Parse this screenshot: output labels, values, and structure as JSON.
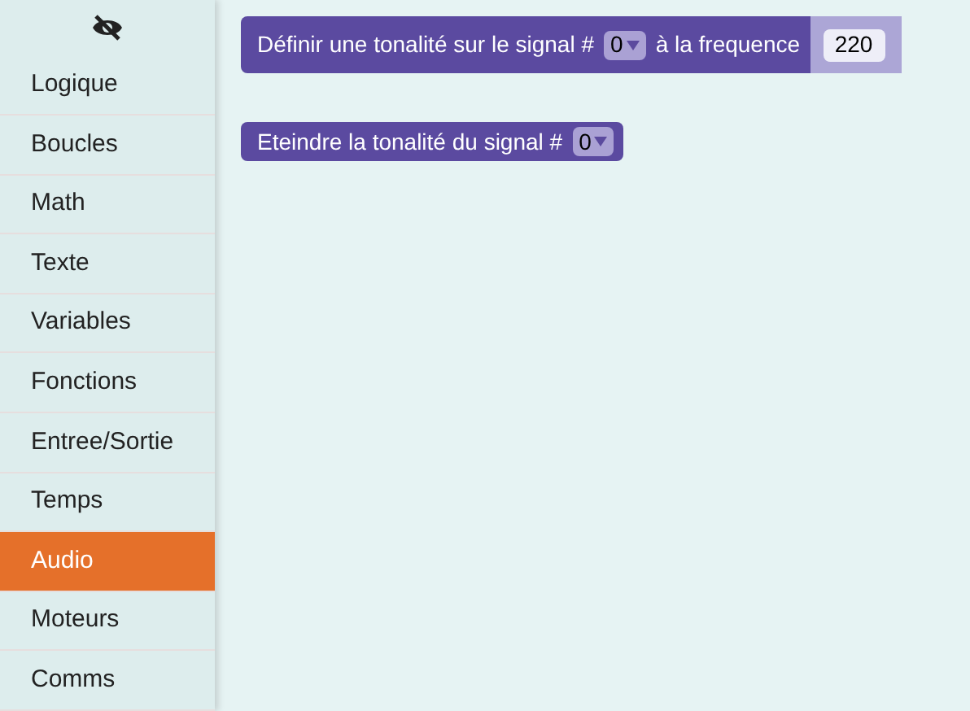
{
  "sidebar": {
    "items": [
      {
        "label": "Logique",
        "selected": false
      },
      {
        "label": "Boucles",
        "selected": false
      },
      {
        "label": "Math",
        "selected": false
      },
      {
        "label": "Texte",
        "selected": false
      },
      {
        "label": "Variables",
        "selected": false
      },
      {
        "label": "Fonctions",
        "selected": false
      },
      {
        "label": "Entree/Sortie",
        "selected": false
      },
      {
        "label": "Temps",
        "selected": false
      },
      {
        "label": "Audio",
        "selected": true
      },
      {
        "label": "Moteurs",
        "selected": false
      },
      {
        "label": "Comms",
        "selected": false
      }
    ]
  },
  "blocks": [
    {
      "parts": [
        {
          "kind": "text",
          "text": "Définir une tonalité sur le signal #"
        },
        {
          "kind": "dropdown",
          "value": "0"
        },
        {
          "kind": "text",
          "text": "à la frequence"
        },
        {
          "kind": "number",
          "value": "220"
        }
      ]
    },
    {
      "parts": [
        {
          "kind": "text",
          "text": "Eteindre la tonalité du signal #"
        },
        {
          "kind": "dropdown",
          "value": "0"
        }
      ]
    }
  ]
}
